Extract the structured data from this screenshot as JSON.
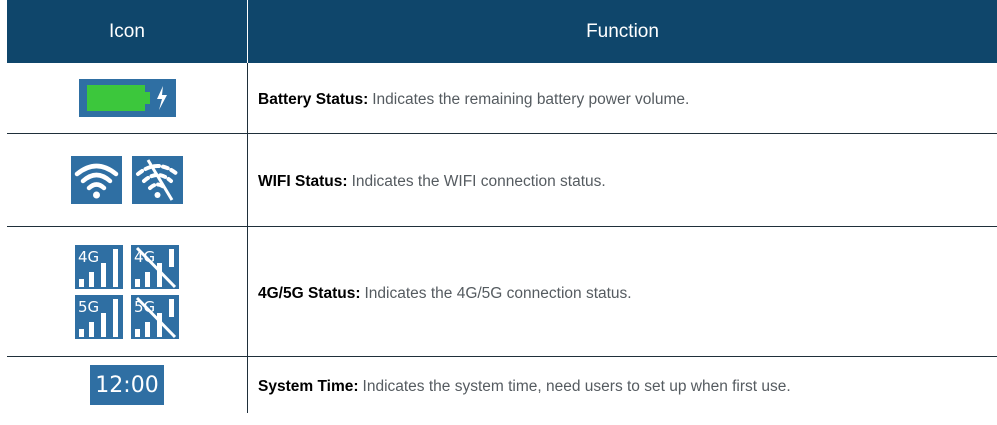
{
  "header": {
    "icon_col": "Icon",
    "function_col": "Function"
  },
  "rows": [
    {
      "icons": [
        "battery-charging-icon"
      ],
      "label": "Battery Status:",
      "desc": "Indicates the remaining battery power volume."
    },
    {
      "icons": [
        "wifi-connected-icon",
        "wifi-disconnected-icon"
      ],
      "label": "WIFI Status:",
      "desc": "Indicates the WIFI connection status."
    },
    {
      "icons": [
        "4g-signal-icon",
        "4g-no-signal-icon",
        "5g-signal-icon",
        "5g-no-signal-icon"
      ],
      "label": "4G/5G Status:",
      "desc": "Indicates the 4G/5G connection status.",
      "icon_text": {
        "g4": "4G",
        "g5": "5G"
      }
    },
    {
      "icons": [
        "system-time-icon"
      ],
      "label": "System Time:",
      "desc": "Indicates the system time, need users to set up when first use.",
      "time": "12:00"
    }
  ],
  "colors": {
    "header_bg": "#0f466b",
    "icon_bg": "#2f6fa3",
    "battery_fill": "#3cc73c"
  }
}
